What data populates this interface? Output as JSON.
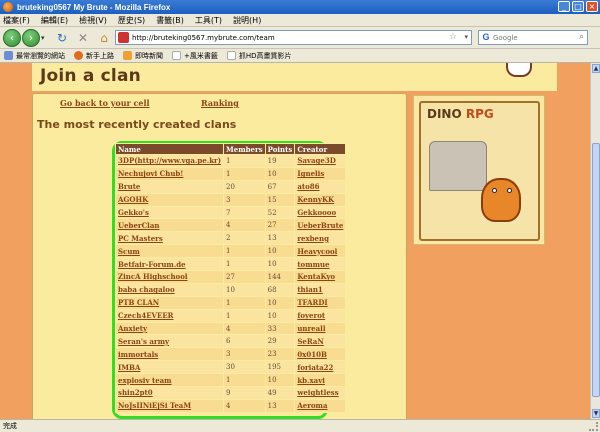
{
  "window": {
    "title": "bruteking0567 My Brute - Mozilla Firefox",
    "min": "_",
    "max": "□",
    "close": "×"
  },
  "menu": [
    "檔案(F)",
    "編輯(E)",
    "檢視(V)",
    "歷史(S)",
    "書籤(B)",
    "工具(T)",
    "說明(H)"
  ],
  "nav": {
    "back": "‹",
    "forward": "›",
    "dropdown": "▾",
    "url": "http://bruteking0567.mybrute.com/team",
    "search_placeholder": "Google"
  },
  "bookmarks": [
    {
      "label": "最常瀏覽的網站",
      "icon": "star-bookmark-icon",
      "color": "#6b8fd6"
    },
    {
      "label": "新手上路",
      "icon": "firefox-icon",
      "color": "#e06b1f"
    },
    {
      "label": "即時新聞",
      "icon": "rss-icon",
      "color": "#f0a030"
    },
    {
      "label": "+風米書籤",
      "icon": "page-icon",
      "color": "#bbbbbb"
    },
    {
      "label": "抓HD高畫質影片",
      "icon": "page-icon",
      "color": "#bbbbbb"
    }
  ],
  "page": {
    "title": "Join a clan",
    "links": {
      "back": "Go back to your cell",
      "ranking": "Ranking"
    },
    "subtitle": "The most recently created clans",
    "banner": {
      "logo_main": "DINO",
      "logo_sub": "RPG"
    }
  },
  "table": {
    "headers": [
      "Name",
      "Members",
      "Points",
      "Creator"
    ],
    "rows": [
      [
        "3DP(http://www.vga.pe.kr)",
        "1",
        "19",
        "Savage3D"
      ],
      [
        "Nechujovi Chub!",
        "1",
        "10",
        "Ignelis"
      ],
      [
        "Brute",
        "20",
        "67",
        "ato86"
      ],
      [
        "AGOHK",
        "3",
        "15",
        "KennyKK"
      ],
      [
        "Gekko's",
        "7",
        "52",
        "Gekkoooo"
      ],
      [
        "UeberClan",
        "4",
        "27",
        "UeberBrute"
      ],
      [
        "PC Masters",
        "2",
        "13",
        "rexbeng"
      ],
      [
        "Scum",
        "1",
        "10",
        "Heavycool"
      ],
      [
        "Betfair-Forum.de",
        "1",
        "10",
        "tommue"
      ],
      [
        "ZincA Highschool",
        "27",
        "144",
        "KentaKyo"
      ],
      [
        "baba chagaloo",
        "10",
        "68",
        "thian1"
      ],
      [
        "PTB CLAN",
        "1",
        "10",
        "TFARDI"
      ],
      [
        "Czech4EVEER",
        "1",
        "10",
        "foyerot"
      ],
      [
        "Anxiety",
        "4",
        "33",
        "unreall"
      ],
      [
        "Seran's army",
        "6",
        "29",
        "SeRaN"
      ],
      [
        "immortals",
        "3",
        "23",
        "0x010B"
      ],
      [
        "IMBA",
        "30",
        "195",
        "foriata22"
      ],
      [
        "explosiv team",
        "1",
        "10",
        "kb.xavi"
      ],
      [
        "shin2pt0",
        "9",
        "49",
        "weightless"
      ],
      [
        "NoJsIINiEjSi TeaM",
        "4",
        "13",
        "Aeroma"
      ]
    ]
  },
  "status": "完成"
}
